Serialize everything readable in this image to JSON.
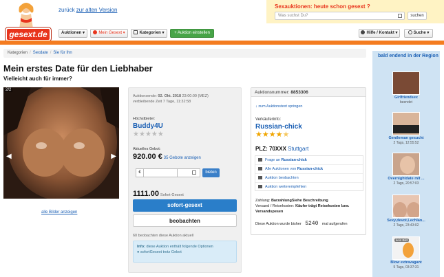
{
  "header": {
    "logo_text": "gesext.de",
    "old_version_prefix": "zurück",
    "old_version_link": "zur alten Version",
    "promo_title": "Sexauktionen: heute schon gesext ?",
    "search_placeholder": "Was suchst Du?",
    "search_button": "suchen"
  },
  "nav": {
    "auktionen": "Auktionen ▾",
    "mein_gesext": "Mein Gesext ▾",
    "kategorien": "Kategorien ▾",
    "auktion_einstellen": "+ Auktion einstellen",
    "hilfe": "Hilfe / Kontakt ▾",
    "suche": "Suche ▾"
  },
  "breadcrumb": [
    "Kategorien",
    "Sexdate",
    "Sie für Ihn"
  ],
  "auction": {
    "title": "Mein erstes Date für den Liebhaber",
    "subtitle": "Vielleicht auch für immer?",
    "image_counter": "2/2",
    "all_images_link": "alle Bilder anzeigen",
    "end_label": "Auktionsende:",
    "end_date": "02. Okt. 2018",
    "end_time": "23:00:00 (MEZ)",
    "remaining": "verbleibende Zeit 7 Tage, 11:32:58",
    "top_bidder_label": "Höchstbieter:",
    "top_bidder": "Buddy4U",
    "current_bid_label": "Aktuelles Gebot:",
    "current_bid": "920.00 €",
    "bid_count_link": "35 Gebote anzeigen",
    "currency": "€",
    "bid_button": "bieten",
    "buy_now_price": "1111.00",
    "buy_now_label": "Sofort-Gesext",
    "buy_now_button": "sofort-gesext",
    "watch_button": "beobachten",
    "watchers": "60 beobachten diese Auktion aktuell",
    "info_title": "Info:",
    "info_text": "diese Auktion enthält folgende Optionen",
    "info_option": "sofortGesext trotz Gebot"
  },
  "seller": {
    "auction_number_label": "Auktionsnummer:",
    "auction_number": "8853306",
    "jump_link": "zum Auktionstext springen",
    "seller_label": "Verkäuferinfo:",
    "seller_name": "Russian-chick",
    "plz_label": "PLZ:",
    "plz": "70XXX",
    "city": "Stuttgart",
    "links": [
      {
        "prefix": "Frage an ",
        "bold": "Russian-chick"
      },
      {
        "prefix": "Alle Auktionen von ",
        "bold": "Russian-chick"
      },
      {
        "prefix": "Auktion beobachten",
        "bold": ""
      },
      {
        "prefix": "Auktion weiterempfehlen",
        "bold": ""
      }
    ],
    "payment_label": "Zahlung:",
    "payment": "BarzahlungSiehe Beschreibung",
    "shipping_label": "Versand / Reisekosten:",
    "shipping": "Käufer trägt Reisekosten bzw. Versandspesen",
    "views_prefix": "Diese Auktion wurde bisher",
    "views_count": "5240",
    "views_suffix": "mal aufgerufen"
  },
  "sidebar": {
    "title": "bald endend in der Region",
    "items": [
      {
        "name": "Girlfriendsex",
        "time": "beendet"
      },
      {
        "name": "Gentleman gesucht",
        "time": "2 Tags, 12:55:52"
      },
      {
        "name": "Overnightdate mit ...",
        "time": "2 Tags, 20:57:03"
      },
      {
        "name": "Sexy,devot,Lechlan...",
        "time": "2 Tags, 23:43:02"
      },
      {
        "name": "Blow extravagant",
        "time": "5 Tags, 03:37:31",
        "badge": "kein Bild"
      }
    ]
  },
  "colors": {
    "accent_orange": "#f47c20",
    "link_blue": "#1a5fb4",
    "button_blue": "#2a7ec9",
    "button_green": "#47a447"
  }
}
